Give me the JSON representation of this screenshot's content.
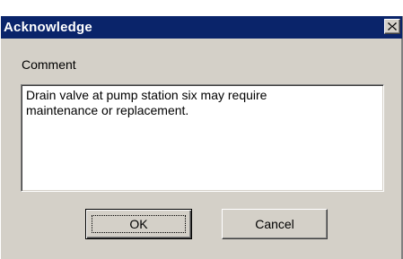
{
  "window": {
    "title": "Acknowledge",
    "close_icon": "close-x-icon"
  },
  "form": {
    "comment_label": "Comment",
    "comment_value": "Drain valve at pump station six may require\nmaintenance or replacement."
  },
  "buttons": {
    "ok_label": "OK",
    "cancel_label": "Cancel"
  },
  "colors": {
    "titlebar": "#0a246a",
    "face": "#d4d0c8"
  }
}
